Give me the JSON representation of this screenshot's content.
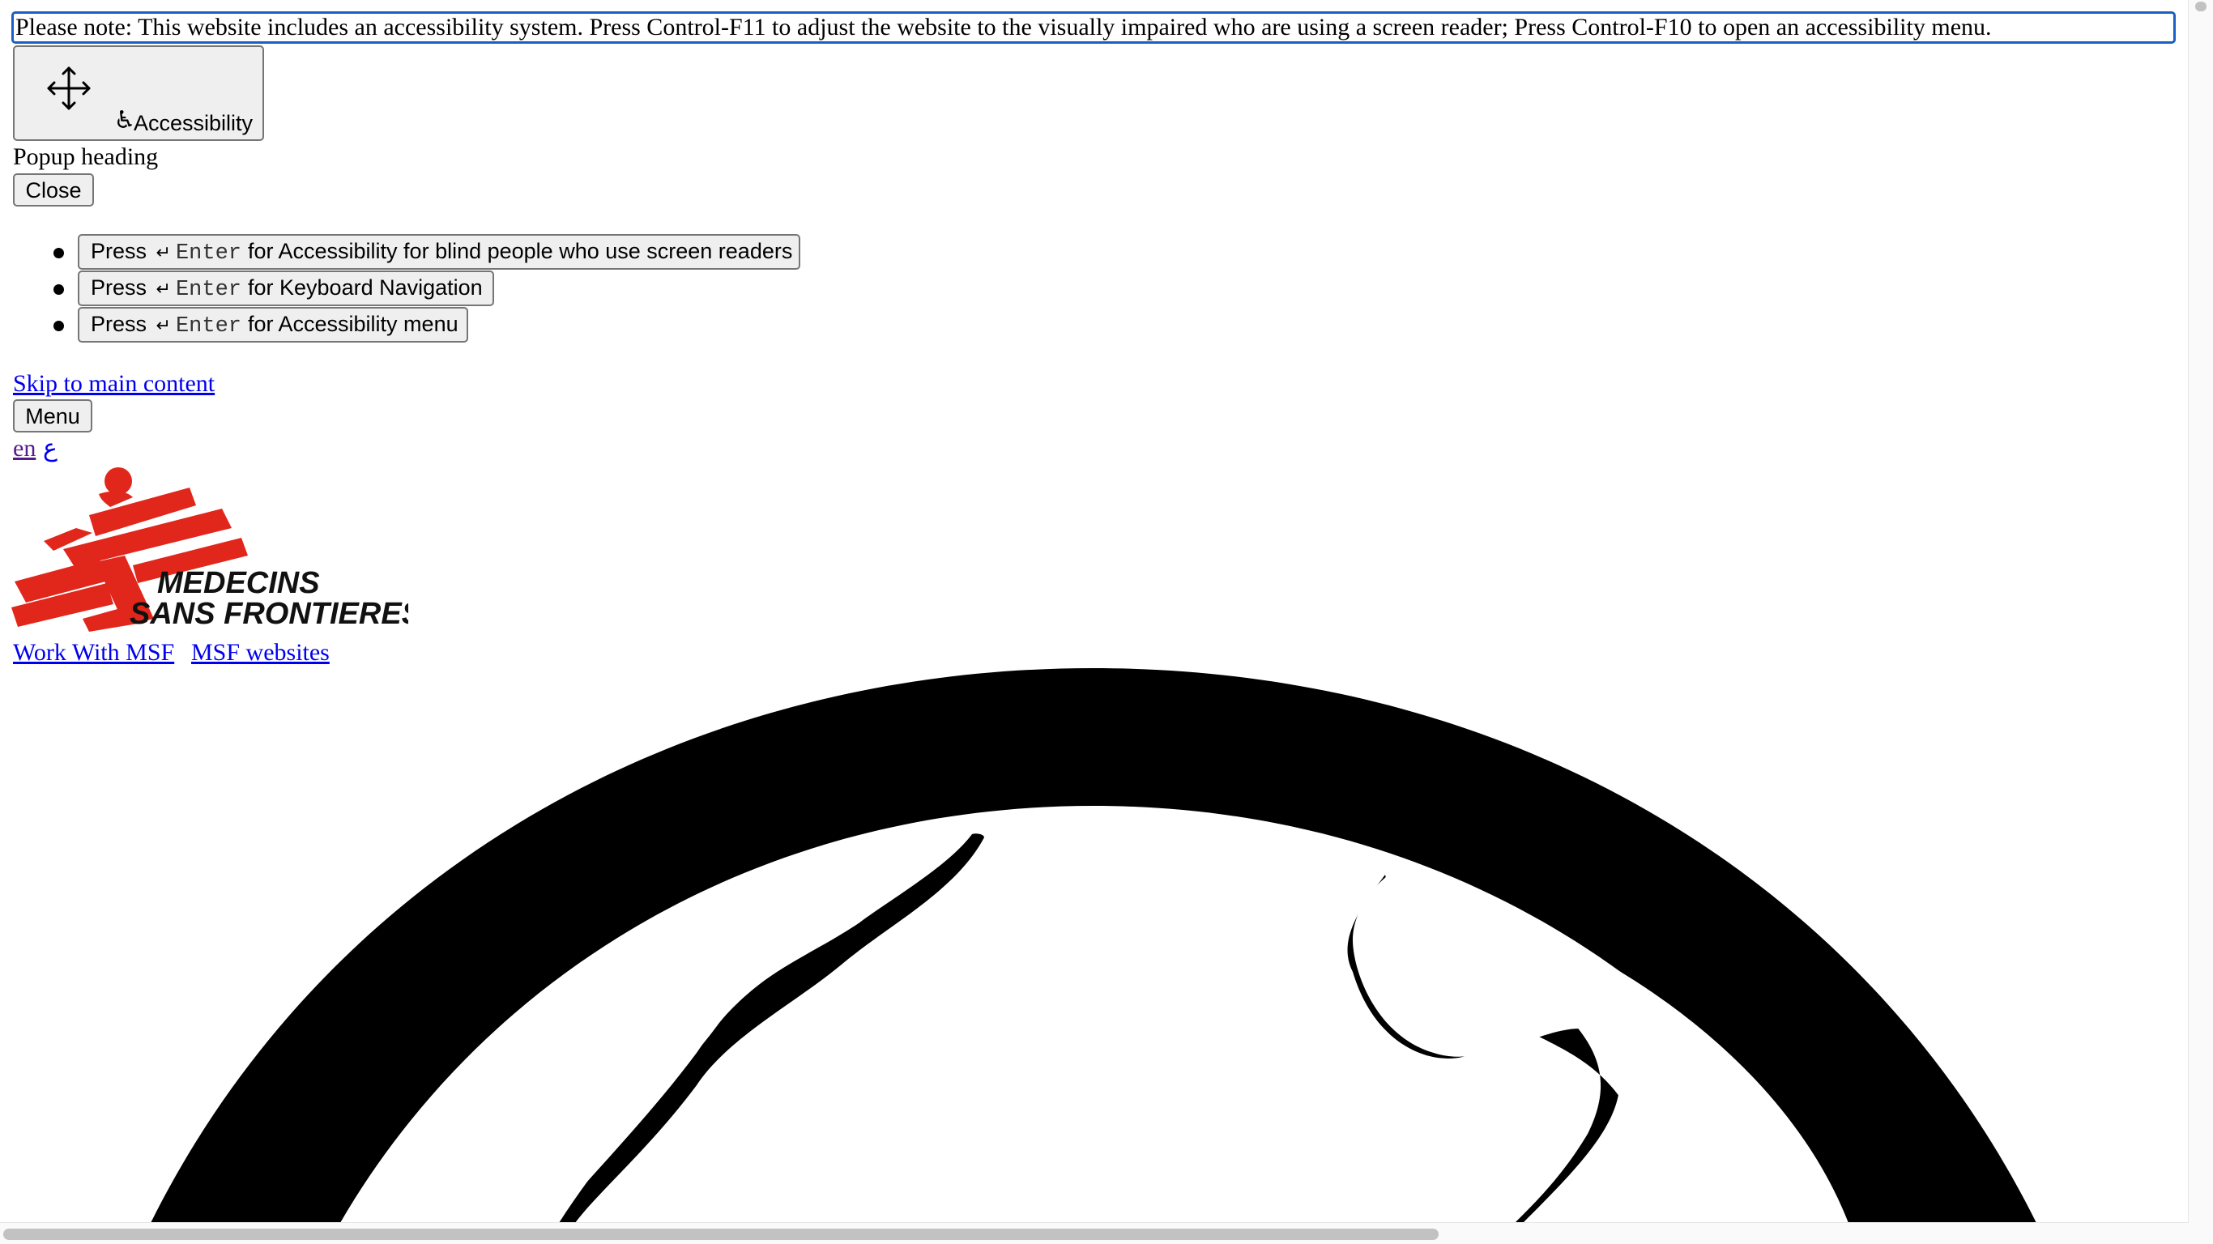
{
  "notice": {
    "text": "Please note: This website includes an accessibility system. Press Control-F11 to adjust the website to the visually impaired who are using a screen reader; Press Control-F10 to open an accessibility menu."
  },
  "accessibility_button": {
    "label": "Accessibility",
    "icons": [
      "move-arrows-icon",
      "wheelchair-icon"
    ]
  },
  "popup": {
    "heading": "Popup heading",
    "close_label": "Close",
    "options": [
      {
        "press": "Press",
        "key": "Enter",
        "action": "for Accessibility for blind people who use screen readers"
      },
      {
        "press": "Press",
        "key": "Enter",
        "action": "for Keyboard Navigation"
      },
      {
        "press": "Press",
        "key": "Enter",
        "action": "for Accessibility menu"
      }
    ]
  },
  "nav": {
    "skip_link": "Skip to main content",
    "menu_label": "Menu",
    "languages": [
      "en",
      "ع"
    ]
  },
  "logo": {
    "line1": "MEDECINS",
    "line2": "SANS FRONTIERES",
    "brand_color": "#e1261c"
  },
  "header_links": {
    "work": "Work With MSF",
    "websites": "MSF websites"
  },
  "colors": {
    "link": "#0000ee",
    "focus_outline": "#1a5fc4",
    "button_bg": "#efefef"
  }
}
